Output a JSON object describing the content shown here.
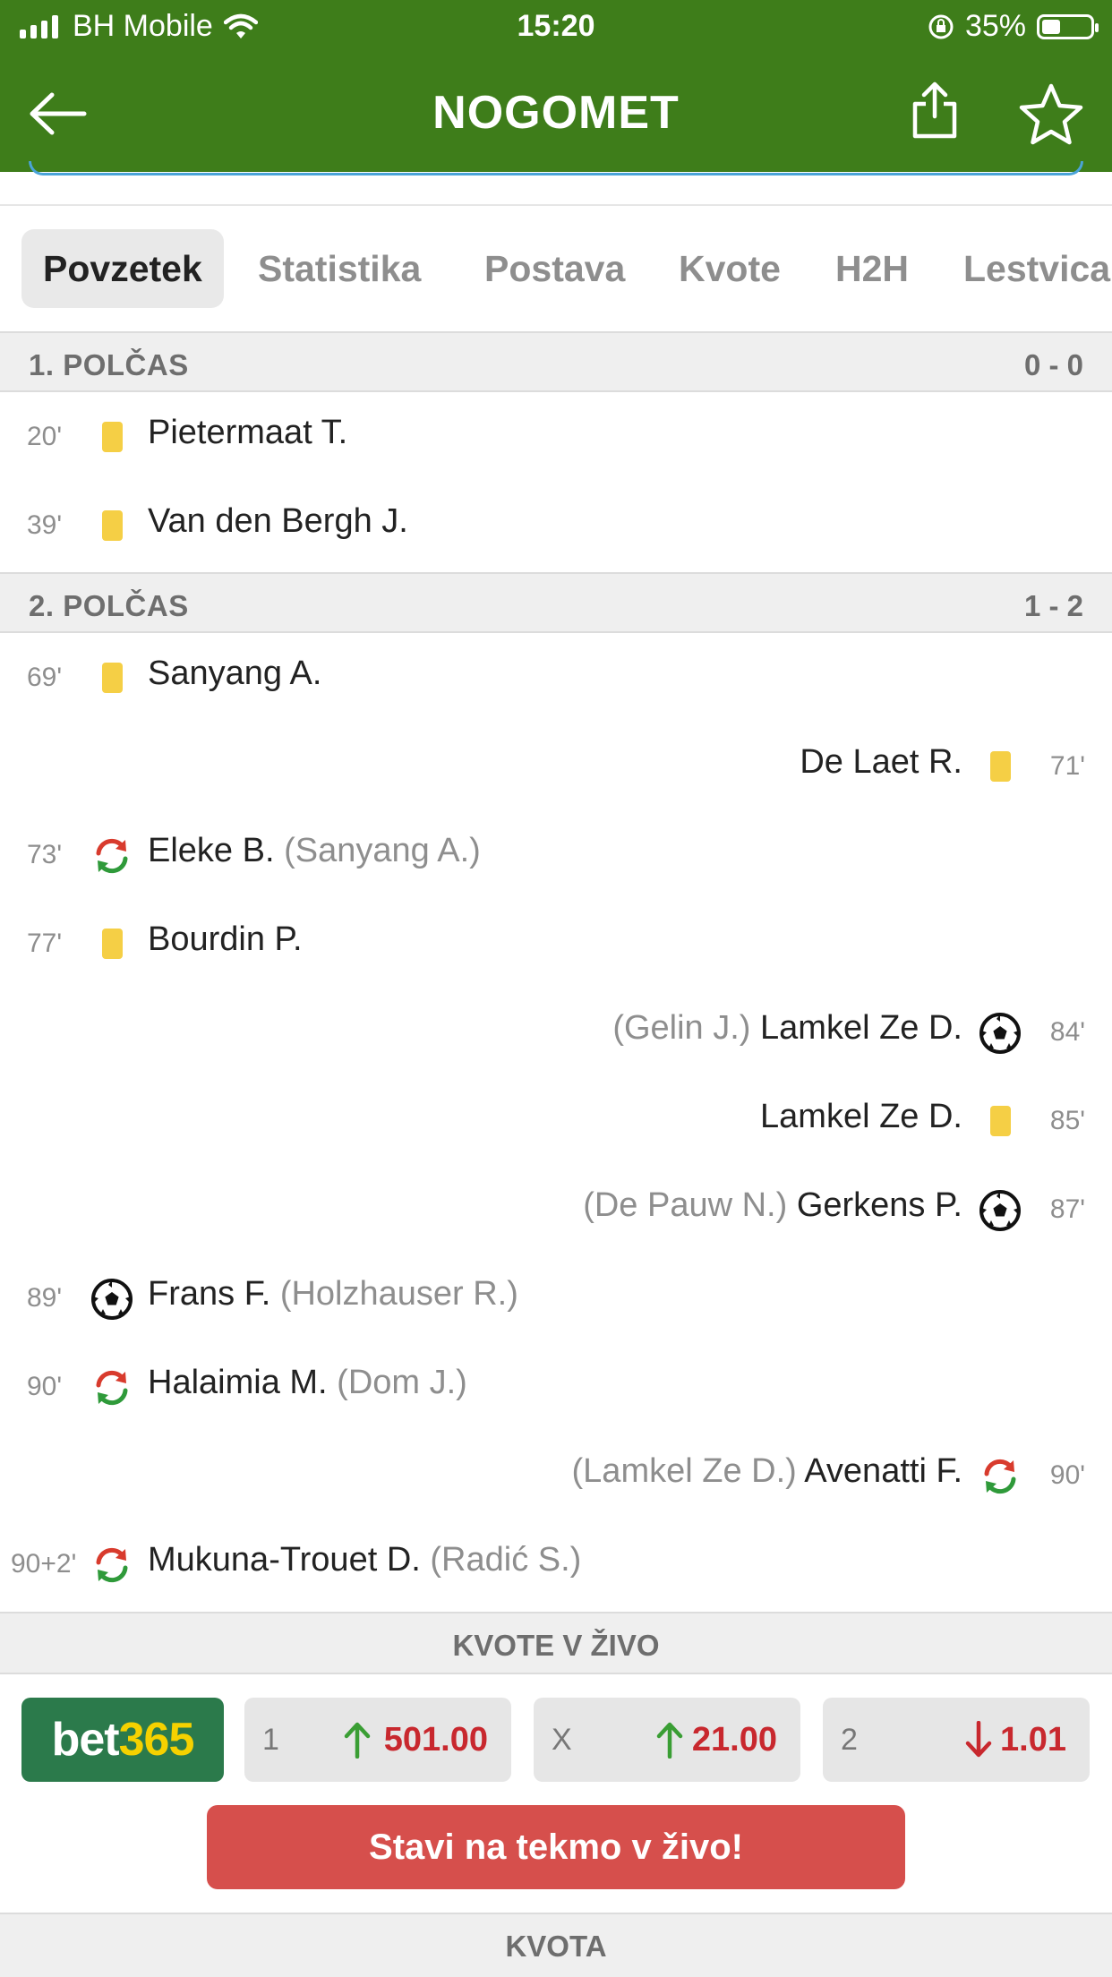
{
  "status_bar": {
    "carrier": "BH Mobile",
    "time": "15:20",
    "battery": "35%"
  },
  "nav": {
    "title": "NOGOMET",
    "back_icon": "back-arrow-icon",
    "share_icon": "share-icon",
    "favorite_icon": "star-icon"
  },
  "tabs": [
    {
      "label": "Povzetek",
      "active": true
    },
    {
      "label": "Statistika"
    },
    {
      "label": "Postava"
    },
    {
      "label": "Kvote"
    },
    {
      "label": "H2H"
    },
    {
      "label": "Lestvica"
    }
  ],
  "sections": [
    {
      "label": "1. POLČAS",
      "score": "0 - 0",
      "events": [
        {
          "minute": "20'",
          "type": "yellow-card",
          "side": "home",
          "player": "Pietermaat T.",
          "extra": ""
        },
        {
          "minute": "39'",
          "type": "yellow-card",
          "side": "home",
          "player": "Van den Bergh J.",
          "extra": ""
        }
      ]
    },
    {
      "label": "2. POLČAS",
      "score": "1 - 2",
      "events": [
        {
          "minute": "69'",
          "type": "yellow-card",
          "side": "home",
          "player": "Sanyang A.",
          "extra": ""
        },
        {
          "minute": "71'",
          "type": "yellow-card",
          "side": "away",
          "player": "De Laet R.",
          "extra": ""
        },
        {
          "minute": "73'",
          "type": "substitution",
          "side": "home",
          "player": "Eleke B.",
          "extra": "(Sanyang A.)"
        },
        {
          "minute": "77'",
          "type": "yellow-card",
          "side": "home",
          "player": "Bourdin P.",
          "extra": ""
        },
        {
          "minute": "84'",
          "type": "goal",
          "side": "away",
          "player": "Lamkel Ze D.",
          "extra": "(Gelin J.)"
        },
        {
          "minute": "85'",
          "type": "yellow-card",
          "side": "away",
          "player": "Lamkel Ze D.",
          "extra": ""
        },
        {
          "minute": "87'",
          "type": "goal",
          "side": "away",
          "player": "Gerkens P.",
          "extra": "(De Pauw N.)"
        },
        {
          "minute": "89'",
          "type": "goal",
          "side": "home",
          "player": "Frans F.",
          "extra": "(Holzhauser R.)"
        },
        {
          "minute": "90'",
          "type": "substitution",
          "side": "home",
          "player": "Halaimia M.",
          "extra": "(Dom J.)"
        },
        {
          "minute": "90'",
          "type": "substitution",
          "side": "away",
          "player": "Avenatti F.",
          "extra": "(Lamkel Ze D.)"
        },
        {
          "minute": "90+2'",
          "type": "substitution",
          "side": "home",
          "player": "Mukuna-Trouet D.",
          "extra": "(Radić S.)"
        }
      ]
    }
  ],
  "odds": {
    "header": "KVOTE V ŽIVO",
    "bookmaker": {
      "part1": "bet",
      "part2": "365"
    },
    "items": [
      {
        "label": "1",
        "value": "501.00",
        "trend": "up"
      },
      {
        "label": "X",
        "value": "21.00",
        "trend": "up"
      },
      {
        "label": "2",
        "value": "1.01",
        "trend": "down"
      }
    ],
    "cta": "Stavi na tekmo v živo!"
  },
  "footer_header": "KVOTA",
  "colors": {
    "header_green": "#3e7d1a",
    "yellow_card": "#f5cf45",
    "odds_red": "#c8282e",
    "trend_up": "#3a9e34",
    "cta_red": "#d64f4c",
    "bet365_green": "#2b7a4b",
    "bet365_yellow": "#f5d100"
  }
}
